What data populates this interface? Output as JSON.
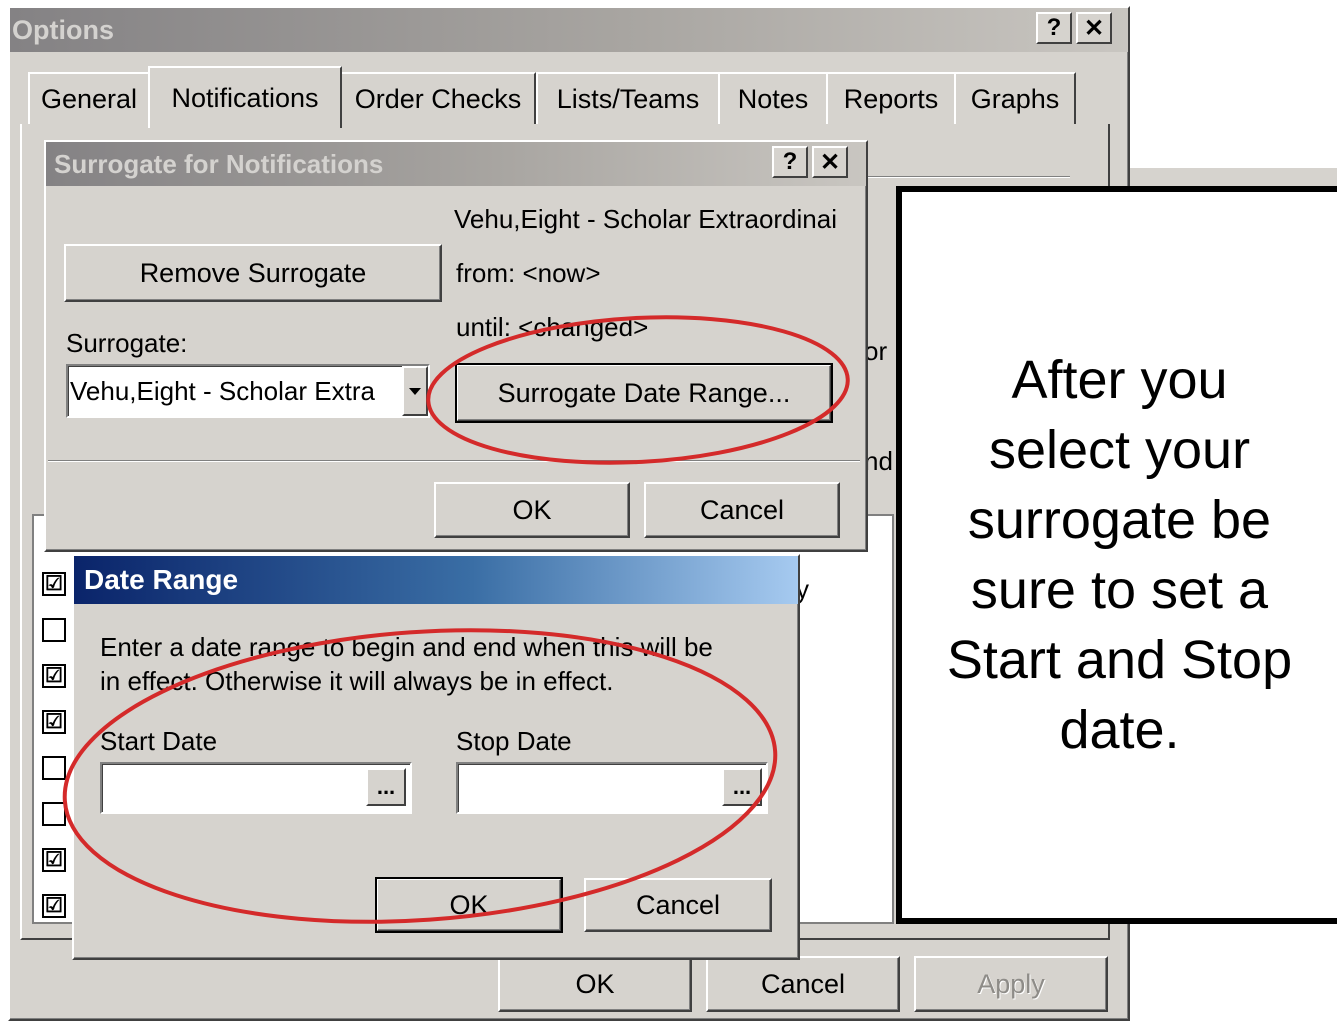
{
  "options": {
    "title": "Options",
    "help_btn": "?",
    "close_btn": "✕",
    "tabs": [
      "General",
      "Notifications",
      "Order Checks",
      "Lists/Teams",
      "Notes",
      "Reports",
      "Graphs"
    ],
    "partial_text_1": "or",
    "partial_text_2": "nd",
    "partial_text_3": "y",
    "checkboxes": [
      "☑",
      "",
      "☑",
      "☑",
      "",
      "",
      "☑",
      "☑"
    ],
    "ok": "OK",
    "cancel": "Cancel",
    "apply": "Apply"
  },
  "surrogate": {
    "title": "Surrogate for Notifications",
    "help_btn": "?",
    "close_btn": "✕",
    "name_line": "Vehu,Eight - Scholar Extraordinai",
    "from_line": "from: <now>",
    "until_line": "until: <changed>",
    "remove_button": "Remove Surrogate",
    "surrogate_label": "Surrogate:",
    "surrogate_value": "Vehu,Eight - Scholar Extra",
    "date_range_button": "Surrogate Date Range...",
    "ok": "OK",
    "cancel": "Cancel"
  },
  "date_range": {
    "title": "Date Range",
    "instructions_1": "Enter a date range to begin and end when this will be",
    "instructions_2": "in effect. Otherwise it will always be in effect.",
    "start_label": "Start Date",
    "stop_label": "Stop Date",
    "start_value": "",
    "stop_value": "",
    "ellipsis": "...",
    "ok": "OK",
    "cancel": "Cancel"
  },
  "callout": {
    "lines": [
      "After you",
      "select your",
      "surrogate be",
      "sure to set a",
      "Start and Stop",
      "date."
    ]
  },
  "colors": {
    "highlight_ellipse": "#d42a2a",
    "dialog_face": "#d6d3ce",
    "active_title": "#0a246a",
    "inactive_title": "#848284"
  }
}
